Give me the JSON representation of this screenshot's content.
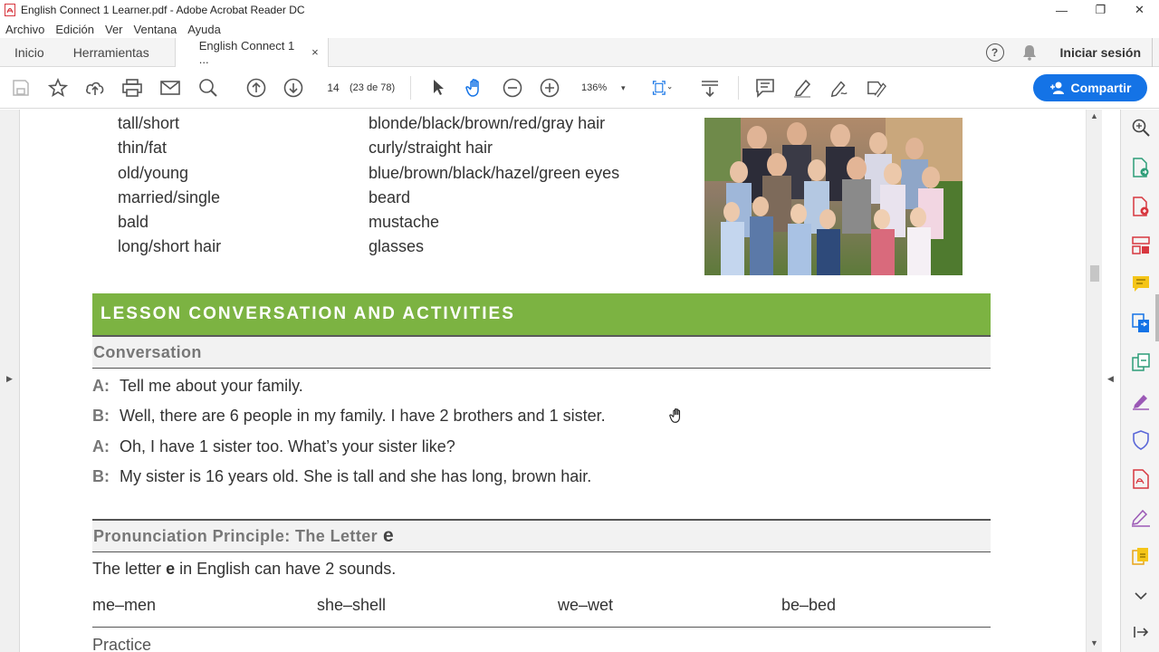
{
  "window": {
    "title": "English Connect 1 Learner.pdf - Adobe Acrobat Reader DC",
    "minimize": "—",
    "restore": "❐",
    "close": "✕"
  },
  "menu": {
    "items": [
      "Archivo",
      "Edición",
      "Ver",
      "Ventana",
      "Ayuda"
    ]
  },
  "tabs": {
    "home": "Inicio",
    "tools": "Herramientas",
    "document": "English Connect 1 ...",
    "close": "×",
    "help": "?",
    "signin": "Iniciar sesión"
  },
  "toolbar": {
    "page_current": "14",
    "page_of": "(23 de 78)",
    "zoom": "136%",
    "zoom_arrow": "▾",
    "share_label": "Compartir",
    "icons": [
      "save-icon",
      "star-icon",
      "upload-icon",
      "print-icon",
      "email-icon",
      "search-icon",
      "page-up-icon",
      "page-down-icon",
      "select-arrow-icon",
      "hand-tool-icon",
      "zoom-out-icon",
      "zoom-in-icon",
      "fit-page-icon",
      "scroll-mode-icon",
      "comment-icon",
      "highlight-icon",
      "sign-icon",
      "fill-form-icon"
    ]
  },
  "document": {
    "vocab_left": [
      "tall/short",
      "thin/fat",
      "old/young",
      "married/single",
      "bald",
      "long/short hair"
    ],
    "vocab_right": [
      "blonde/black/brown/red/gray hair",
      "curly/straight hair",
      "blue/brown/black/hazel/green eyes",
      "beard",
      "mustache",
      "glasses"
    ],
    "lesson_header": "LESSON CONVERSATION AND ACTIVITIES",
    "conversation_header": "Conversation",
    "conversation": [
      {
        "speaker": "A:",
        "text": "Tell me about your family."
      },
      {
        "speaker": "B:",
        "text": "Well, there are 6 people in my family. I have 2 brothers and 1 sister."
      },
      {
        "speaker": "A:",
        "text": "Oh, I have 1 sister too. What’s your sister like?"
      },
      {
        "speaker": "B:",
        "text": "My sister is 16 years old. She is tall and she has long, brown hair."
      }
    ],
    "pronunciation_header": "Pronunciation Principle: The Letter",
    "pronunciation_letter": "e",
    "letter_line_prefix": "The letter",
    "letter_line_letter": "e",
    "letter_line_suffix": "in English can have 2 sounds.",
    "pairs": [
      "me–men",
      "she–shell",
      "we–wet",
      "be–bed"
    ],
    "practice": "Practice"
  },
  "colors": {
    "lesson_header_bg": "#7cb342",
    "share_button": "#1473e6",
    "acrobat_red": "#d7373f"
  }
}
